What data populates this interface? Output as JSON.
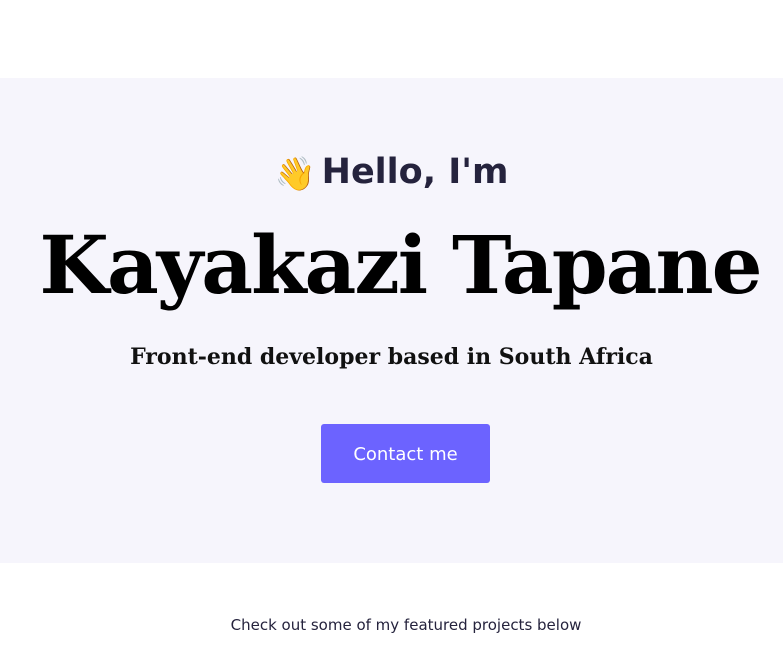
{
  "hero": {
    "greeting_icon": "waving-hand-icon",
    "greeting_emoji": "👋",
    "greeting_text": "Hello, I'm",
    "name": "Kayakazi Tapane",
    "tagline": "Front-end developer based in South Africa",
    "contact_button_label": "Contact me"
  },
  "projects": {
    "intro_text": "Check out some of my featured projects below"
  },
  "colors": {
    "hero_background": "#f6f5fc",
    "accent": "#6c63ff",
    "heading_dark": "#25233d"
  }
}
